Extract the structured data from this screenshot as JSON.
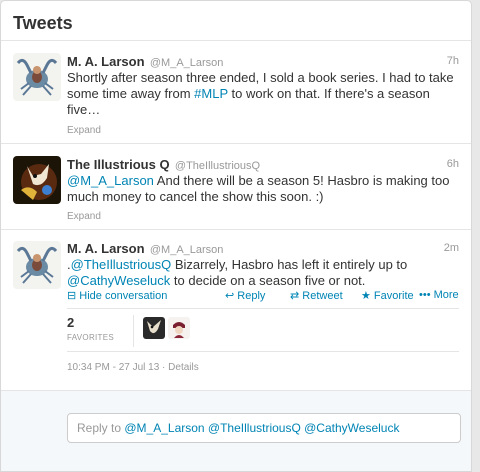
{
  "header": {
    "title": "Tweets"
  },
  "tweets": [
    {
      "fullname": "M. A. Larson",
      "username": "@M_A_Larson",
      "time": "7h",
      "text_before": "Shortly after season three ended, I sold a book series. I had to take some time away from ",
      "hashtag": "#MLP",
      "text_after": " to work on that. If there's a season five…",
      "expand": "Expand"
    },
    {
      "fullname": "The Illustrious Q",
      "username": "@TheIllustriousQ",
      "time": "6h",
      "mention": "@M_A_Larson",
      "text_after": " And there will be a season 5! Hasbro is making too much money to cancel the show this soon. :)",
      "expand": "Expand"
    },
    {
      "fullname": "M. A. Larson",
      "username": "@M_A_Larson",
      "time": "2m",
      "prefix": ".",
      "mention1": "@TheIllustriousQ",
      "text_middle": " Bizarrely, Hasbro has left it entirely up to ",
      "mention2": "@CathyWeseluck",
      "text_after": " to decide on a season five or not.",
      "actions": {
        "hide": "Hide conversation",
        "reply": "Reply",
        "retweet": "Retweet",
        "favorite": "Favorite",
        "more": "More"
      },
      "stats": {
        "favorites_count": "2",
        "favorites_label": "FAVORITES"
      },
      "meta": {
        "datetime": "10:34 PM - 27 Jul 13",
        "separator": " · ",
        "details": "Details"
      }
    }
  ],
  "reply": {
    "prefix": "Reply to ",
    "mentions": "@M_A_Larson @TheIllustriousQ @CathyWeseluck"
  },
  "colors": {
    "link": "#0084b4",
    "muted": "#999999",
    "text": "#333333"
  }
}
